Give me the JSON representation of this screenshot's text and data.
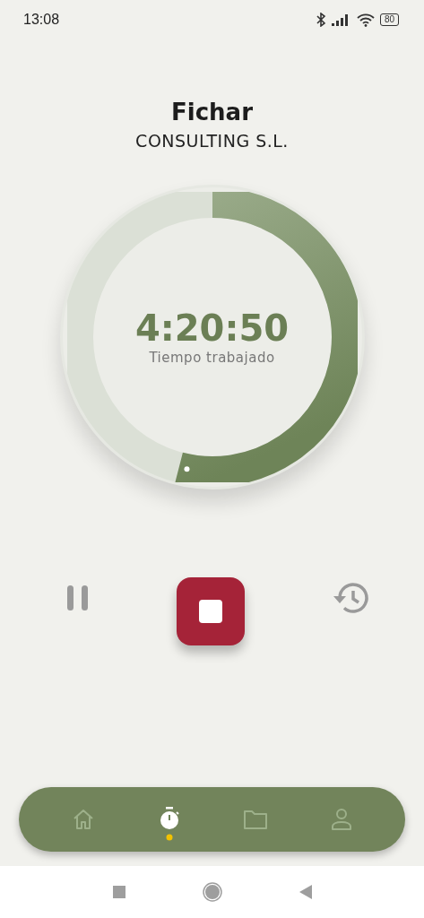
{
  "status_bar": {
    "time": "13:08",
    "battery": "80"
  },
  "header": {
    "title": "Fichar",
    "company": "CONSULTING S.L."
  },
  "timer": {
    "elapsed": "4:20:50",
    "label": "Tiempo trabajado"
  },
  "controls": [
    {
      "kind": "pause"
    },
    {
      "kind": "stop"
    },
    {
      "kind": "history"
    }
  ],
  "nav": [
    {
      "kind": "home",
      "selected": false
    },
    {
      "kind": "timer",
      "selected": true
    },
    {
      "kind": "folder",
      "selected": false
    },
    {
      "kind": "profile",
      "selected": false
    }
  ]
}
